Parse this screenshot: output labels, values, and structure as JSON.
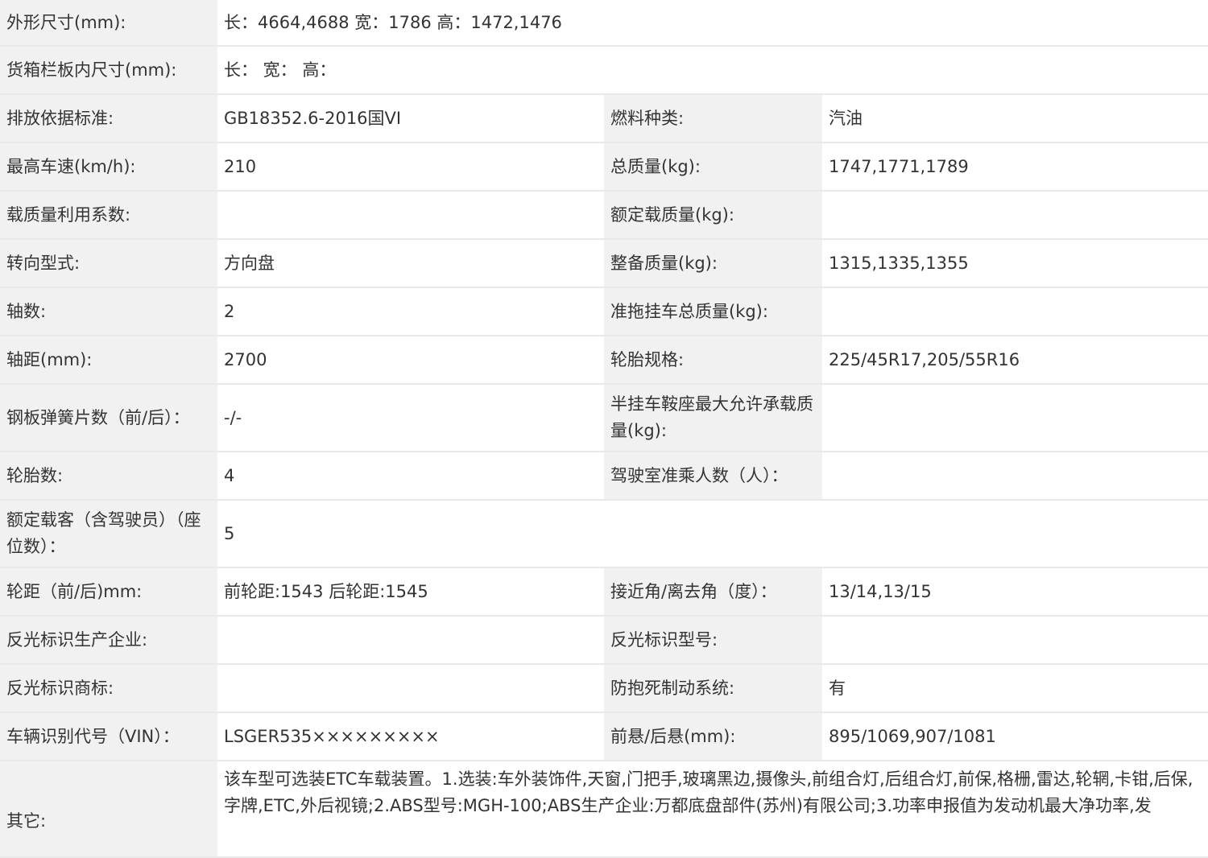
{
  "rows": [
    {
      "label": "外形尺寸(mm):",
      "value": "长：4664,4688 宽：1786 高：1472,1476"
    },
    {
      "label": "货箱栏板内尺寸(mm):",
      "value": "长：  宽：  高："
    },
    {
      "label": "排放依据标准:",
      "value": "GB18352.6-2016国VI",
      "label2": "燃料种类:",
      "value2": "汽油"
    },
    {
      "label": "最高车速(km/h):",
      "value": "210",
      "label2": "总质量(kg):",
      "value2": "1747,1771,1789"
    },
    {
      "label": "载质量利用系数:",
      "value": "",
      "label2": "额定载质量(kg):",
      "value2": ""
    },
    {
      "label": "转向型式:",
      "value": "方向盘",
      "label2": "整备质量(kg):",
      "value2": "1315,1335,1355"
    },
    {
      "label": "轴数:",
      "value": "2",
      "label2": "准拖挂车总质量(kg):",
      "value2": ""
    },
    {
      "label": "轴距(mm):",
      "value": "2700",
      "label2": "轮胎规格:",
      "value2": "225/45R17,205/55R16"
    },
    {
      "label": "钢板弹簧片数（前/后）：",
      "value": "-/-",
      "label2": "半挂车鞍座最大允许承载质量(kg):",
      "value2": ""
    },
    {
      "label": "轮胎数:",
      "value": "4",
      "label2": "驾驶室准乘人数（人）：",
      "value2": ""
    },
    {
      "label": "额定载客（含驾驶员）（座位数）：",
      "value": "5"
    },
    {
      "label": "轮距（前/后)mm:",
      "value": "前轮距:1543 后轮距:1545",
      "label2": "接近角/离去角（度）：",
      "value2": "13/14,13/15"
    },
    {
      "label": "反光标识生产企业:",
      "value": "",
      "label2": "反光标识型号:",
      "value2": ""
    },
    {
      "label": "反光标识商标:",
      "value": "",
      "label2": "防抱死制动系统:",
      "value2": "有"
    },
    {
      "label": "车辆识别代号（VIN）：",
      "value": "LSGER535×××××××××",
      "label2": "前悬/后悬(mm):",
      "value2": "895/1069,907/1081"
    },
    {
      "label": "其它:",
      "value": "该车型可选装ETC车载装置。1.选装:车外装饰件,天窗,门把手,玻璃黑边,摄像头,前组合灯,后组合灯,前保,格栅,雷达,轮辋,卡钳,后保,字牌,ETC,外后视镜;2.ABS型号:MGH-100;ABS生产企业:万都底盘部件(苏州)有限公司;3.功率申报值为发动机最大净功率,发"
    }
  ]
}
